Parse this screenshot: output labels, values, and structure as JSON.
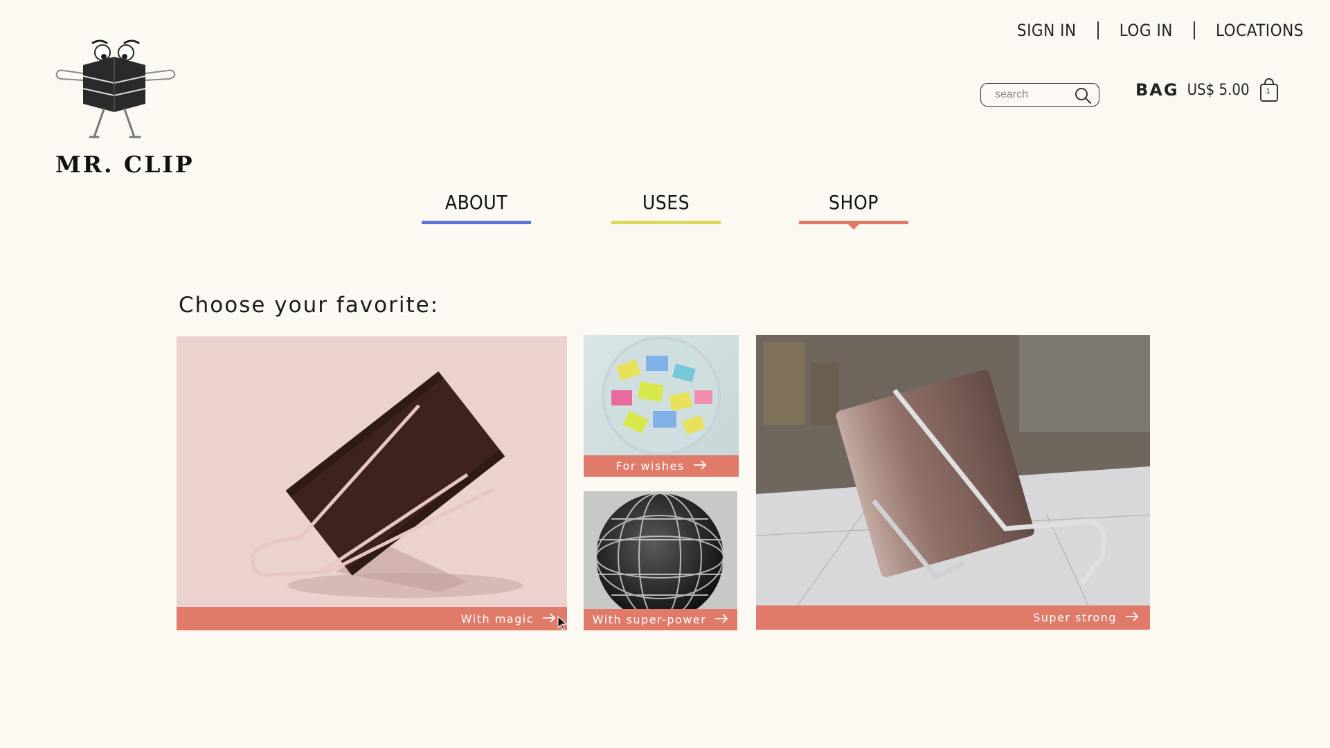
{
  "brand": {
    "name": "MR. CLIP"
  },
  "top_links": {
    "sign_in": "SIGN IN",
    "log_in": "LOG IN",
    "locations": "LOCATIONS"
  },
  "search": {
    "placeholder": "search"
  },
  "bag": {
    "label": "BAG",
    "amount": "US$ 5.00",
    "count": "1"
  },
  "nav": [
    {
      "label": "ABOUT",
      "color": "#5b74d6"
    },
    {
      "label": "USES",
      "color": "#d9d65b"
    },
    {
      "label": "SHOP",
      "color": "#e07b6a",
      "active": true
    }
  ],
  "main": {
    "heading": "Choose your favorite:",
    "cards": [
      {
        "caption": "With magic"
      },
      {
        "caption": "For wishes"
      },
      {
        "caption": "With super-power"
      },
      {
        "caption": "Super strong"
      }
    ]
  },
  "colors": {
    "background": "#fcf9f3",
    "accent": "#e07b6a"
  }
}
